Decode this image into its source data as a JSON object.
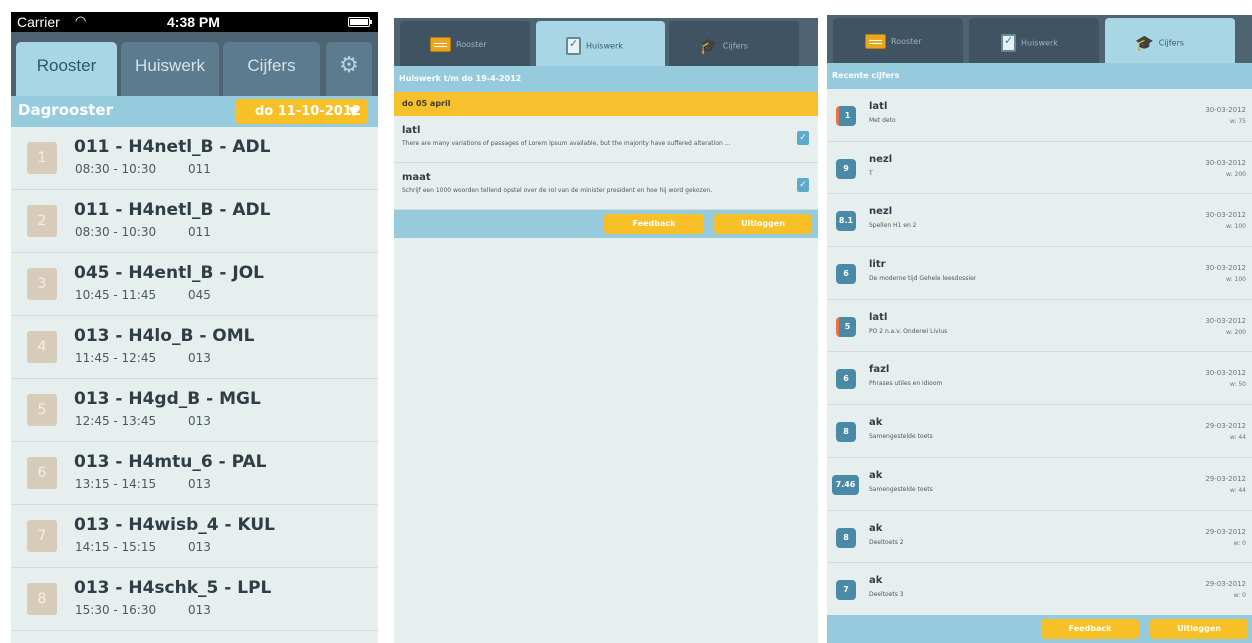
{
  "panel1": {
    "status": {
      "carrier": "Carrier",
      "time": "4:38 PM"
    },
    "tabs": [
      "Rooster",
      "Huiswerk",
      "Cijfers"
    ],
    "subheader": {
      "title": "Dagrooster",
      "date": "do 11-10-2012"
    },
    "rows": [
      {
        "n": "1",
        "title": "011 - H4netl_B - ADL",
        "time": "08:30 - 10:30",
        "room": "011"
      },
      {
        "n": "2",
        "title": "011 - H4netl_B - ADL",
        "time": "08:30 - 10:30",
        "room": "011"
      },
      {
        "n": "3",
        "title": "045 - H4entl_B - JOL",
        "time": "10:45 - 11:45",
        "room": "045"
      },
      {
        "n": "4",
        "title": "013 - H4lo_B - OML",
        "time": "11:45 - 12:45",
        "room": "013"
      },
      {
        "n": "5",
        "title": "013 - H4gd_B - MGL",
        "time": "12:45 - 13:45",
        "room": "013"
      },
      {
        "n": "6",
        "title": "013 - H4mtu_6 - PAL",
        "time": "13:15 - 14:15",
        "room": "013"
      },
      {
        "n": "7",
        "title": "013 - H4wisb_4 - KUL",
        "time": "14:15 - 15:15",
        "room": "013"
      },
      {
        "n": "8",
        "title": "013 - H4schk_5 - LPL",
        "time": "15:30 - 16:30",
        "room": "013"
      }
    ]
  },
  "panel2": {
    "tabs": [
      "Rooster",
      "Huiswerk",
      "Cijfers"
    ],
    "header": "Huiswerk t/m do 19-4-2012",
    "date": "do 05 april",
    "items": [
      {
        "subject": "latl",
        "desc": "There are many variations of passages of Lorem Ipsum available, but the majority have suffered alteration ..."
      },
      {
        "subject": "maat",
        "desc": "Schrijf een 1000 woorden tellend opstel over de rol van de minister president en hoe hij word gekozen."
      }
    ],
    "buttons": {
      "feedback": "Feedback",
      "logout": "Uitloggen"
    }
  },
  "panel3": {
    "tabs": [
      "Rooster",
      "Huiswerk",
      "Cijfers"
    ],
    "header": "Recente cijfers",
    "grades": [
      {
        "grade": "1",
        "subject": "latl",
        "desc": "Met deto",
        "date": "30-03-2012",
        "weight": "w: 75"
      },
      {
        "grade": "9",
        "subject": "nezl",
        "desc": "T",
        "date": "30-03-2012",
        "weight": "w: 200"
      },
      {
        "grade": "8.1",
        "subject": "nezl",
        "desc": "Spellen H1 en 2",
        "date": "30-03-2012",
        "weight": "w: 100"
      },
      {
        "grade": "6",
        "subject": "litr",
        "desc": "De moderne tijd Gehele leesdossier",
        "date": "30-03-2012",
        "weight": "w: 100"
      },
      {
        "grade": "5",
        "subject": "latl",
        "desc": "PO 2 n.a.v. Onderwi Livius",
        "date": "30-03-2012",
        "weight": "w: 200"
      },
      {
        "grade": "6",
        "subject": "fazl",
        "desc": "Phrases utiles en idioom",
        "date": "30-03-2012",
        "weight": "w: 50"
      },
      {
        "grade": "8",
        "subject": "ak",
        "desc": "Samengestelde toets",
        "date": "29-03-2012",
        "weight": "w: 44"
      },
      {
        "grade": "7.46",
        "subject": "ak",
        "desc": "Samengestelde toets",
        "date": "29-03-2012",
        "weight": "w: 44"
      },
      {
        "grade": "8",
        "subject": "ak",
        "desc": "Deeltoets 2",
        "date": "29-03-2012",
        "weight": "w: 0"
      },
      {
        "grade": "7",
        "subject": "ak",
        "desc": "Deeltoets 3",
        "date": "29-03-2012",
        "weight": "w: 0"
      }
    ],
    "buttons": {
      "feedback": "Feedback",
      "logout": "Uitloggen"
    }
  },
  "colors": {
    "accent": "#f8c027",
    "header": "#96cbde",
    "tab_active": "#a9d6e5",
    "badge": "#4a8aa7",
    "low_grade_marker": "#e8754a"
  },
  "icons": {
    "schedule": "calendar-icon",
    "homework": "clipboard-check-icon",
    "grades": "graduation-cap-icon",
    "settings": "gear-icon"
  }
}
